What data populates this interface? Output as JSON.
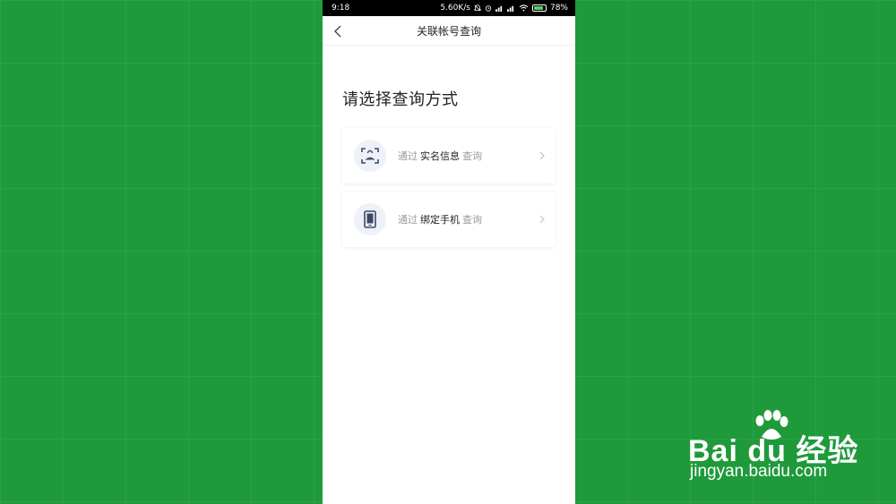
{
  "status_bar": {
    "time": "9:18",
    "network_speed": "5.60K/s",
    "battery_percent": "78%",
    "icons": [
      "mute-icon",
      "alarm-icon",
      "signal-icon",
      "signal-icon",
      "wifi-icon",
      "battery-icon"
    ]
  },
  "nav": {
    "title": "关联帐号查询",
    "back_icon": "chevron-left-icon"
  },
  "heading": "请选择查询方式",
  "options": [
    {
      "prefix": "通过",
      "keyword": "实名信息",
      "suffix": "查询",
      "icon": "face-scan-icon"
    },
    {
      "prefix": "通过",
      "keyword": "绑定手机",
      "suffix": "查询",
      "icon": "phone-icon"
    }
  ],
  "watermark": {
    "logo": "Bai du 经验",
    "url": "jingyan.baidu.com"
  },
  "colors": {
    "background_green": "#1f9a3a",
    "icon_bg": "#eef1f7",
    "icon_fg": "#3d4a66",
    "muted_text": "#9a9a9a"
  }
}
